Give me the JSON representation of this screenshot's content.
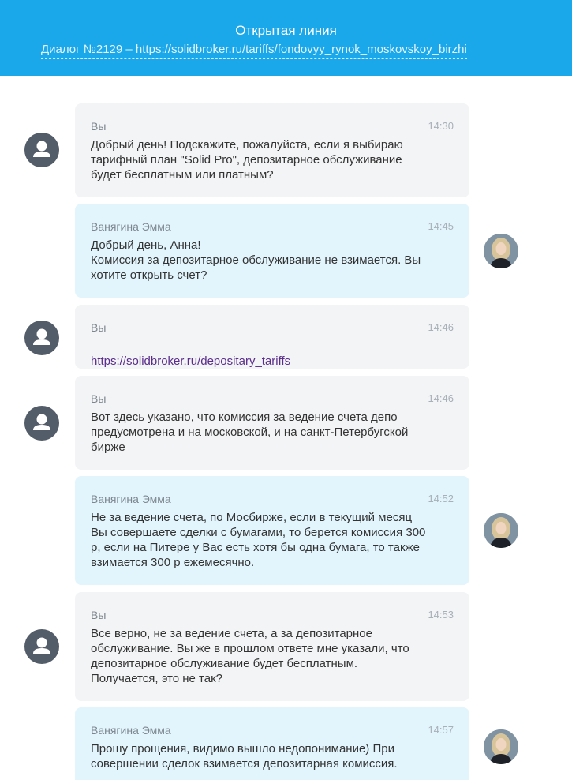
{
  "header": {
    "title": "Открытая линия",
    "subtitle": "Диалог №2129 – https://solidbroker.ru/tariffs/fondovyy_rynok_moskovskoy_birzhi"
  },
  "colors": {
    "accent": "#1ba8ea",
    "client_bubble": "#f3f4f6",
    "operator_bubble": "#e2f5fd"
  },
  "messages": [
    {
      "sender": "client",
      "author": "Вы",
      "time": "14:30",
      "text": "Добрый день! Подскажите, пожалуйста, если я выбираю\nтарифный план \"Solid Pro\", депозитарное обслуживание\nбудет бесплатным или платным?"
    },
    {
      "sender": "operator",
      "author": "Ванягина Эмма",
      "time": "14:45",
      "text": "Добрый день, Анна!\nКомиссия за депозитарное обслуживание не взимается. Вы\nхотите открыть счет?"
    },
    {
      "sender": "client",
      "author": "Вы",
      "time": "14:46",
      "link": "https://solidbroker.ru/depositary_tariffs"
    },
    {
      "sender": "client",
      "author": "Вы",
      "time": "14:46",
      "text": "Вот здесь указано, что комиссия за ведение счета депо\nпредусмотрена и на московской, и на санкт-Петербугской\nбирже"
    },
    {
      "sender": "operator",
      "author": "Ванягина Эмма",
      "time": "14:52",
      "text": "Не за ведение счета, по Мосбирже, если в текущий месяц\nВы совершаете сделки с бумагами, то берется комиссия 300\nр, если на Питере у Вас есть хотя бы одна бумага, то также\nвзимается 300 р ежемесячно."
    },
    {
      "sender": "client",
      "author": "Вы",
      "time": "14:53",
      "text": "Все верно, не за ведение счета, а за депозитарное\nобслуживание. Вы же в прошлом ответе мне указали, что\nдепозитарное обслуживание будет бесплатным.\nПолучается, это не так?"
    },
    {
      "sender": "operator",
      "author": "Ванягина Эмма",
      "time": "14:57",
      "text": "Прошу прощения, видимо вышло недопонимание) При\nсовершении сделок взимается депозитарная комиссия."
    }
  ]
}
